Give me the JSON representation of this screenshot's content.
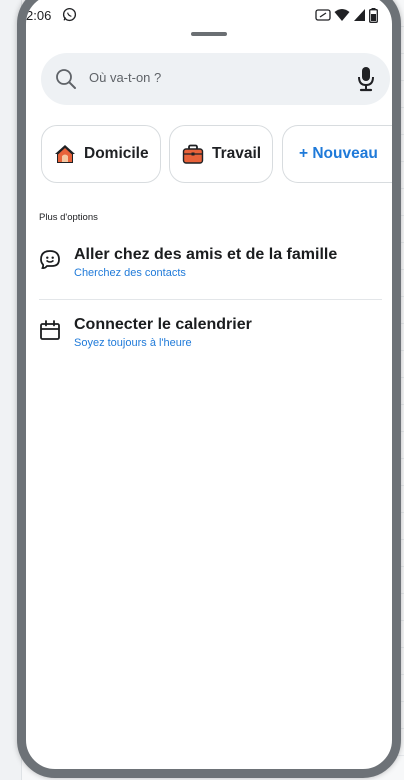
{
  "status_bar": {
    "time": "2:06",
    "icons": [
      "whatsapp-icon",
      "nfc-icon",
      "wifi-icon",
      "signal-icon",
      "battery-icon"
    ]
  },
  "search": {
    "placeholder": "Où va-t-on ?",
    "icon": "search-icon",
    "voice_icon": "mic-icon"
  },
  "quick_places": [
    {
      "label": "Domicile",
      "icon": "home-icon",
      "icon_color": "#e8623a"
    },
    {
      "label": "Travail",
      "icon": "briefcase-icon",
      "icon_color": "#e8623a"
    },
    {
      "label": "+ Nouveau",
      "icon": "",
      "color": "#1f7ad9"
    }
  ],
  "more_options": {
    "label": "Plus d'options",
    "items": [
      {
        "title": "Aller chez des amis et de la famille",
        "subtitle": "Cherchez des contacts",
        "icon": "waze-smile-icon"
      },
      {
        "title": "Connecter le calendrier",
        "subtitle": "Soyez toujours à l'heure",
        "icon": "calendar-icon"
      }
    ]
  },
  "colors": {
    "accent": "#1f7ad9",
    "search_bg": "#eef1f4",
    "chip_border": "#d8dcdf",
    "frame": "#6d7277"
  }
}
